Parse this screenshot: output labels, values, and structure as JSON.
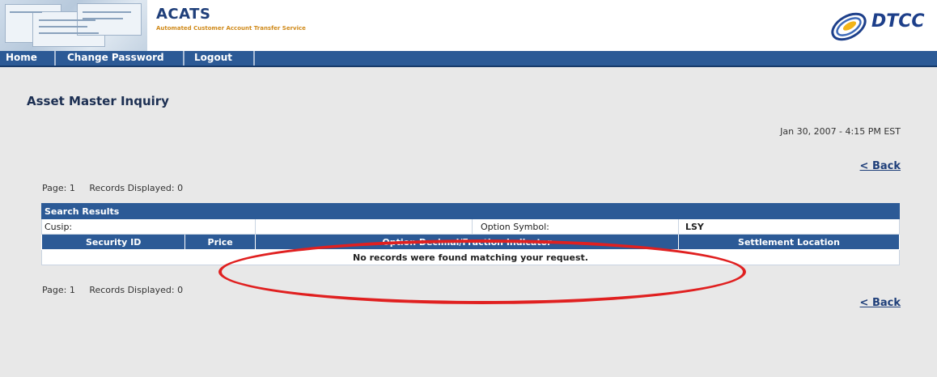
{
  "header": {
    "app_title": "ACATS",
    "app_subtitle": "Automated Customer Account Transfer Service",
    "brand": "DTCC"
  },
  "nav": {
    "items": [
      {
        "label": "Home"
      },
      {
        "label": "Change Password"
      },
      {
        "label": "Logout"
      }
    ]
  },
  "page": {
    "title": "Asset Master Inquiry",
    "timestamp": "Jan 30, 2007 - 4:15 PM EST",
    "back_label": "< Back"
  },
  "paging": {
    "page_label": "Page: 1",
    "records_label": "Records Displayed: 0"
  },
  "results": {
    "caption": "Search Results",
    "criteria": {
      "cusip_label": "Cusip:",
      "cusip_value": "",
      "option_symbol_label": "Option Symbol:",
      "option_symbol_value": "LSY"
    },
    "columns": [
      "Security ID",
      "Price",
      "Option Decimal/Fraction Indicator",
      "Settlement Location"
    ],
    "empty_message": "No records were found matching your request."
  },
  "colors": {
    "nav_bg": "#2c5a96",
    "title": "#1c2f52",
    "annotation": "#e02020",
    "subtitle": "#d08a1a"
  }
}
